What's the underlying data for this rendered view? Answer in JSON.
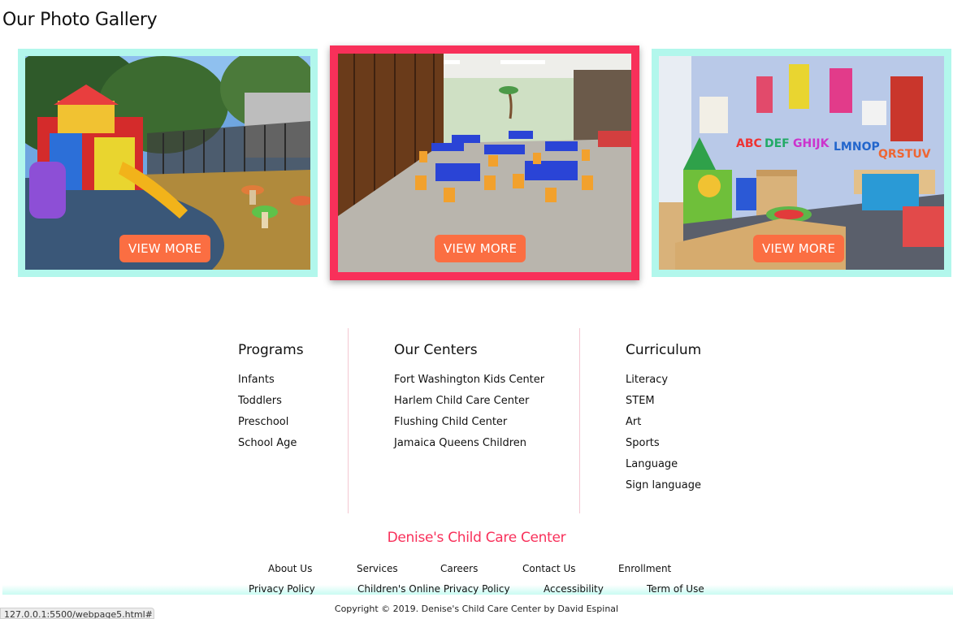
{
  "gallery": {
    "title": "Our Photo Gallery",
    "cards": [
      {
        "image": "Outdoor playground with colorful slide",
        "button": "VIEW MORE"
      },
      {
        "image": "Classroom with blue tables and orange chairs",
        "button": "VIEW MORE"
      },
      {
        "image": "Toddler play room with alphabet wall",
        "button": "VIEW MORE"
      }
    ]
  },
  "footer": {
    "columns": [
      {
        "heading": "Programs",
        "items": [
          "Infants",
          "Toddlers",
          "Preschool",
          "School Age"
        ]
      },
      {
        "heading": "Our Centers",
        "items": [
          "Fort Washington Kids Center",
          "Harlem Child Care Center",
          "Flushing Child Center",
          "Jamaica Queens Children"
        ]
      },
      {
        "heading": "Curriculum",
        "items": [
          "Literacy",
          "STEM",
          "Art",
          "Sports",
          "Language",
          "Sign language"
        ]
      }
    ],
    "brand": "Denise's Child Care Center",
    "nav": [
      "About Us",
      "Services",
      "Careers",
      "Contact Us",
      "Enrollment"
    ],
    "legal": [
      "Privacy Policy",
      "Children's Online Privacy Policy",
      "Accessibility",
      "Term of Use"
    ],
    "copyright": "Copyright © 2019. Denise's Child Care Center by David Espinal"
  },
  "statusbar": {
    "url": "127.0.0.1:5500/webpage5.html#"
  },
  "colors": {
    "card_border": "#b2f7ec",
    "card_active_border": "#f8305a",
    "button": "#fb6e42",
    "brand": "#f8305a"
  }
}
